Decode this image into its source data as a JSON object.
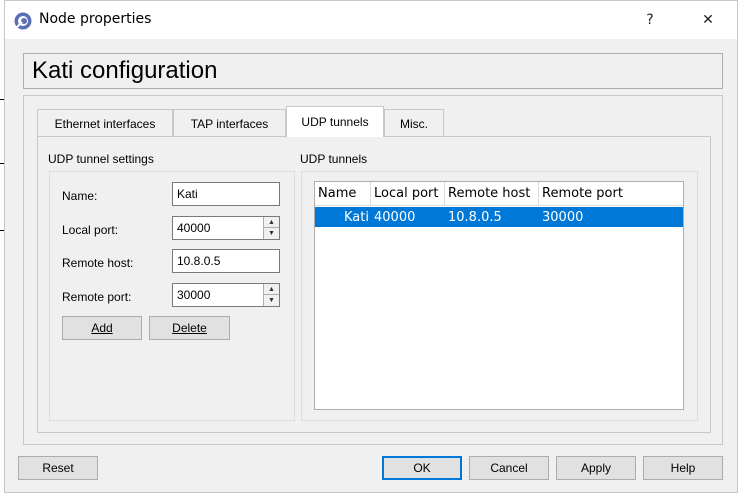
{
  "window": {
    "title": "Node properties",
    "help_glyph": "?",
    "close_glyph": "✕",
    "icon": "app-logo-icon"
  },
  "header": {
    "title": "Kati configuration"
  },
  "tabs": [
    {
      "label": "Ethernet interfaces",
      "active": false
    },
    {
      "label": "TAP interfaces",
      "active": false
    },
    {
      "label": "UDP tunnels",
      "active": true
    },
    {
      "label": "Misc.",
      "active": false
    }
  ],
  "settings": {
    "group_title": "UDP tunnel settings",
    "name_label": "Name:",
    "name_value": "Kati",
    "local_port_label": "Local port:",
    "local_port_value": "40000",
    "remote_host_label": "Remote host:",
    "remote_host_value": "10.8.0.5",
    "remote_port_label": "Remote port:",
    "remote_port_value": "30000",
    "add_label": "Add",
    "delete_label": "Delete"
  },
  "tunnels": {
    "group_title": "UDP tunnels",
    "columns": [
      "Name",
      "Local port",
      "Remote host",
      "Remote port"
    ],
    "rows": [
      {
        "name": "Kati",
        "local_port": "40000",
        "remote_host": "10.8.0.5",
        "remote_port": "30000",
        "selected": true
      }
    ]
  },
  "footer": {
    "reset": "Reset",
    "ok": "OK",
    "cancel": "Cancel",
    "apply": "Apply",
    "help": "Help"
  },
  "colors": {
    "selection": "#0078d7",
    "dialog_bg": "#f0f0f0"
  }
}
